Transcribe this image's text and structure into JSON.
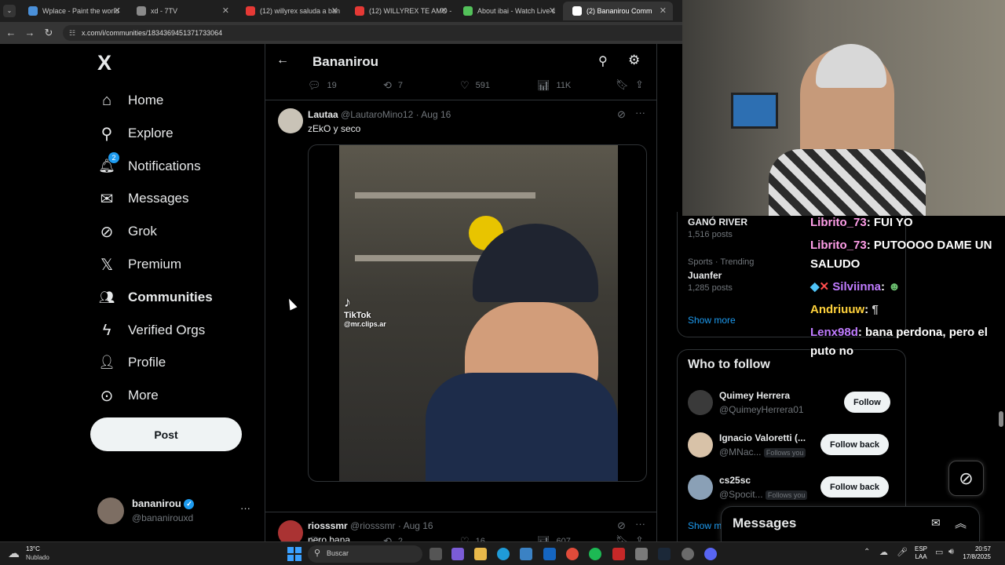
{
  "browser": {
    "tabs": [
      {
        "label": "Wplace - Paint the world",
        "color": "#4a90d9"
      },
      {
        "label": "xd - 7TV",
        "color": "#8a8a8a"
      },
      {
        "label": "(12) willyrex saluda a ban",
        "color": "#e53935"
      },
      {
        "label": "(12) WILLYREX TE AMO -",
        "color": "#e53935"
      },
      {
        "label": "About ibai - Watch Live c",
        "color": "#53c15a"
      },
      {
        "label": "(2) Bananirou Comm",
        "color": "#ffffff"
      }
    ],
    "url": "x.com/i/communities/1834369451371733064"
  },
  "sidebar": {
    "logo": "X",
    "items": [
      {
        "label": "Home",
        "icon": "home-icon",
        "glyph": "⌂"
      },
      {
        "label": "Explore",
        "icon": "search-icon",
        "glyph": "⚲"
      },
      {
        "label": "Notifications",
        "icon": "bell-icon",
        "glyph": "🔔︎",
        "badge": "2"
      },
      {
        "label": "Messages",
        "icon": "mail-icon",
        "glyph": "✉"
      },
      {
        "label": "Grok",
        "icon": "grok-icon",
        "glyph": "⊘"
      },
      {
        "label": "Premium",
        "icon": "x-premium-icon",
        "glyph": "𝕏"
      },
      {
        "label": "Communities",
        "icon": "communities-icon",
        "glyph": "👥︎"
      },
      {
        "label": "Verified Orgs",
        "icon": "lightning-icon",
        "glyph": "ϟ"
      },
      {
        "label": "Profile",
        "icon": "person-icon",
        "glyph": "👤︎"
      },
      {
        "label": "More",
        "icon": "more-circle-icon",
        "glyph": "⊙"
      }
    ],
    "post_label": "Post",
    "account": {
      "name": "bananirou",
      "handle": "@bananirouxd",
      "more": "···"
    }
  },
  "header": {
    "title": "Bananirou"
  },
  "prev_actions": {
    "replies": "19",
    "reposts": "7",
    "likes": "591",
    "views": "11K"
  },
  "tweet": {
    "name": "Lautaa",
    "handle": "@LautaroMino12",
    "date": "· Aug 16",
    "text": "zEkO y seco",
    "video_watermark": "TikTok",
    "video_handle": "@mr.clips.ar",
    "actions": {
      "replies": "",
      "reposts": "2",
      "likes": "16",
      "views": "607"
    }
  },
  "next_tweet": {
    "name": "riosssmr",
    "handle": "@riosssmr",
    "date": "· Aug 16",
    "text": "pero bana"
  },
  "trending": [
    {
      "title": "GANÓ RIVER",
      "posts": "1,516 posts"
    },
    {
      "meta": "Sports · Trending",
      "title": "Juanfer",
      "posts": "1,285 posts"
    }
  ],
  "show_more": "Show more",
  "who_to_follow": {
    "title": "Who to follow",
    "users": [
      {
        "name": "Quimey Herrera",
        "handle": "@QuimeyHerrera01",
        "follows_you": "",
        "button": "Follow"
      },
      {
        "name": "Ignacio Valoretti (...",
        "handle": "@MNac...",
        "follows_you": "Follows you",
        "button": "Follow back"
      },
      {
        "name": "cs25sc",
        "handle": "@Spocit...",
        "follows_you": "Follows you",
        "button": "Follow back"
      }
    ],
    "show_more": "Show m"
  },
  "messages_drawer": {
    "label": "Messages"
  },
  "chat": [
    {
      "user": "Librito_73",
      "text": ": FUI YO",
      "color": "#ff9ee8"
    },
    {
      "user": "Librito_73",
      "text": ": PUTOOOO DAME UN SALUDO",
      "color": "#ff9ee8"
    },
    {
      "user": "Silviinna",
      "text": ":",
      "color": "#c07cff"
    },
    {
      "user": "Andriuuw",
      "text": ":",
      "color": "#ffd23c"
    },
    {
      "user": "Lenx98d",
      "text": ": bana perdona, pero el puto no",
      "color": "#c07cff"
    }
  ],
  "taskbar": {
    "weather_temp": "13°C",
    "weather_desc": "Nublado",
    "search_placeholder": "Buscar",
    "lang": "ESP",
    "lang2": "LAA",
    "time": "20:57",
    "date": "17/8/2025"
  }
}
